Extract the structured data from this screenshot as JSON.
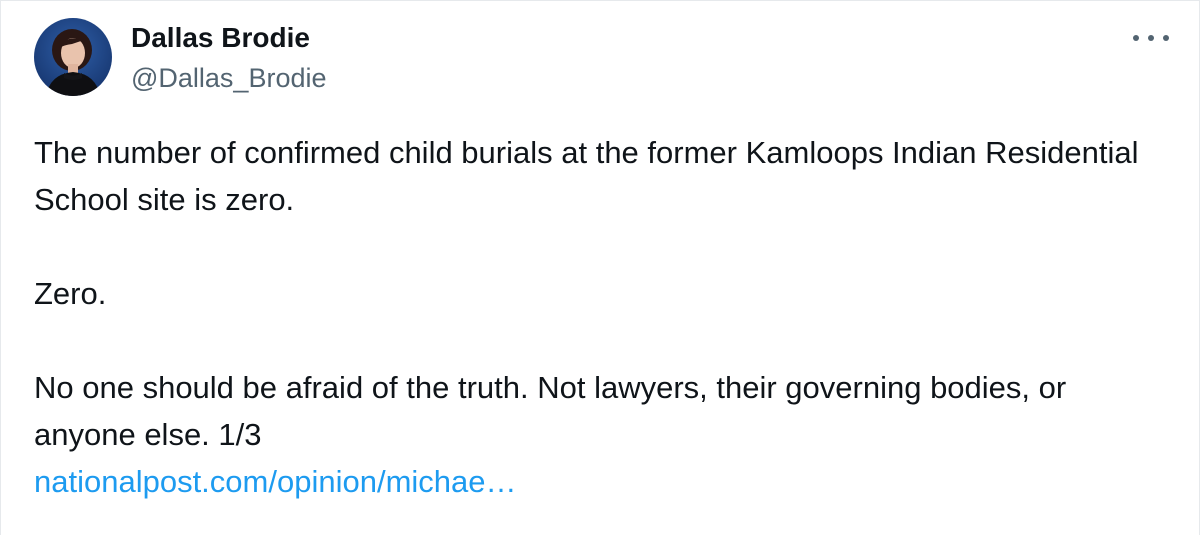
{
  "author": {
    "display_name": "Dallas Brodie",
    "handle": "@Dallas_Brodie",
    "avatar_icon": "profile-photo"
  },
  "menu": {
    "icon": "more-options-icon"
  },
  "tweet": {
    "paragraph_1": "The number of confirmed child burials at the former Kamloops Indian Residential School site is zero.",
    "paragraph_2": "Zero.",
    "paragraph_3": "No one should be afraid of the truth. Not lawyers, their governing bodies, or anyone else. 1/3",
    "link_text": "nationalpost.com/opinion/michae…"
  },
  "colors": {
    "text": "#0f1419",
    "secondary": "#536471",
    "link": "#1d9bf0"
  }
}
